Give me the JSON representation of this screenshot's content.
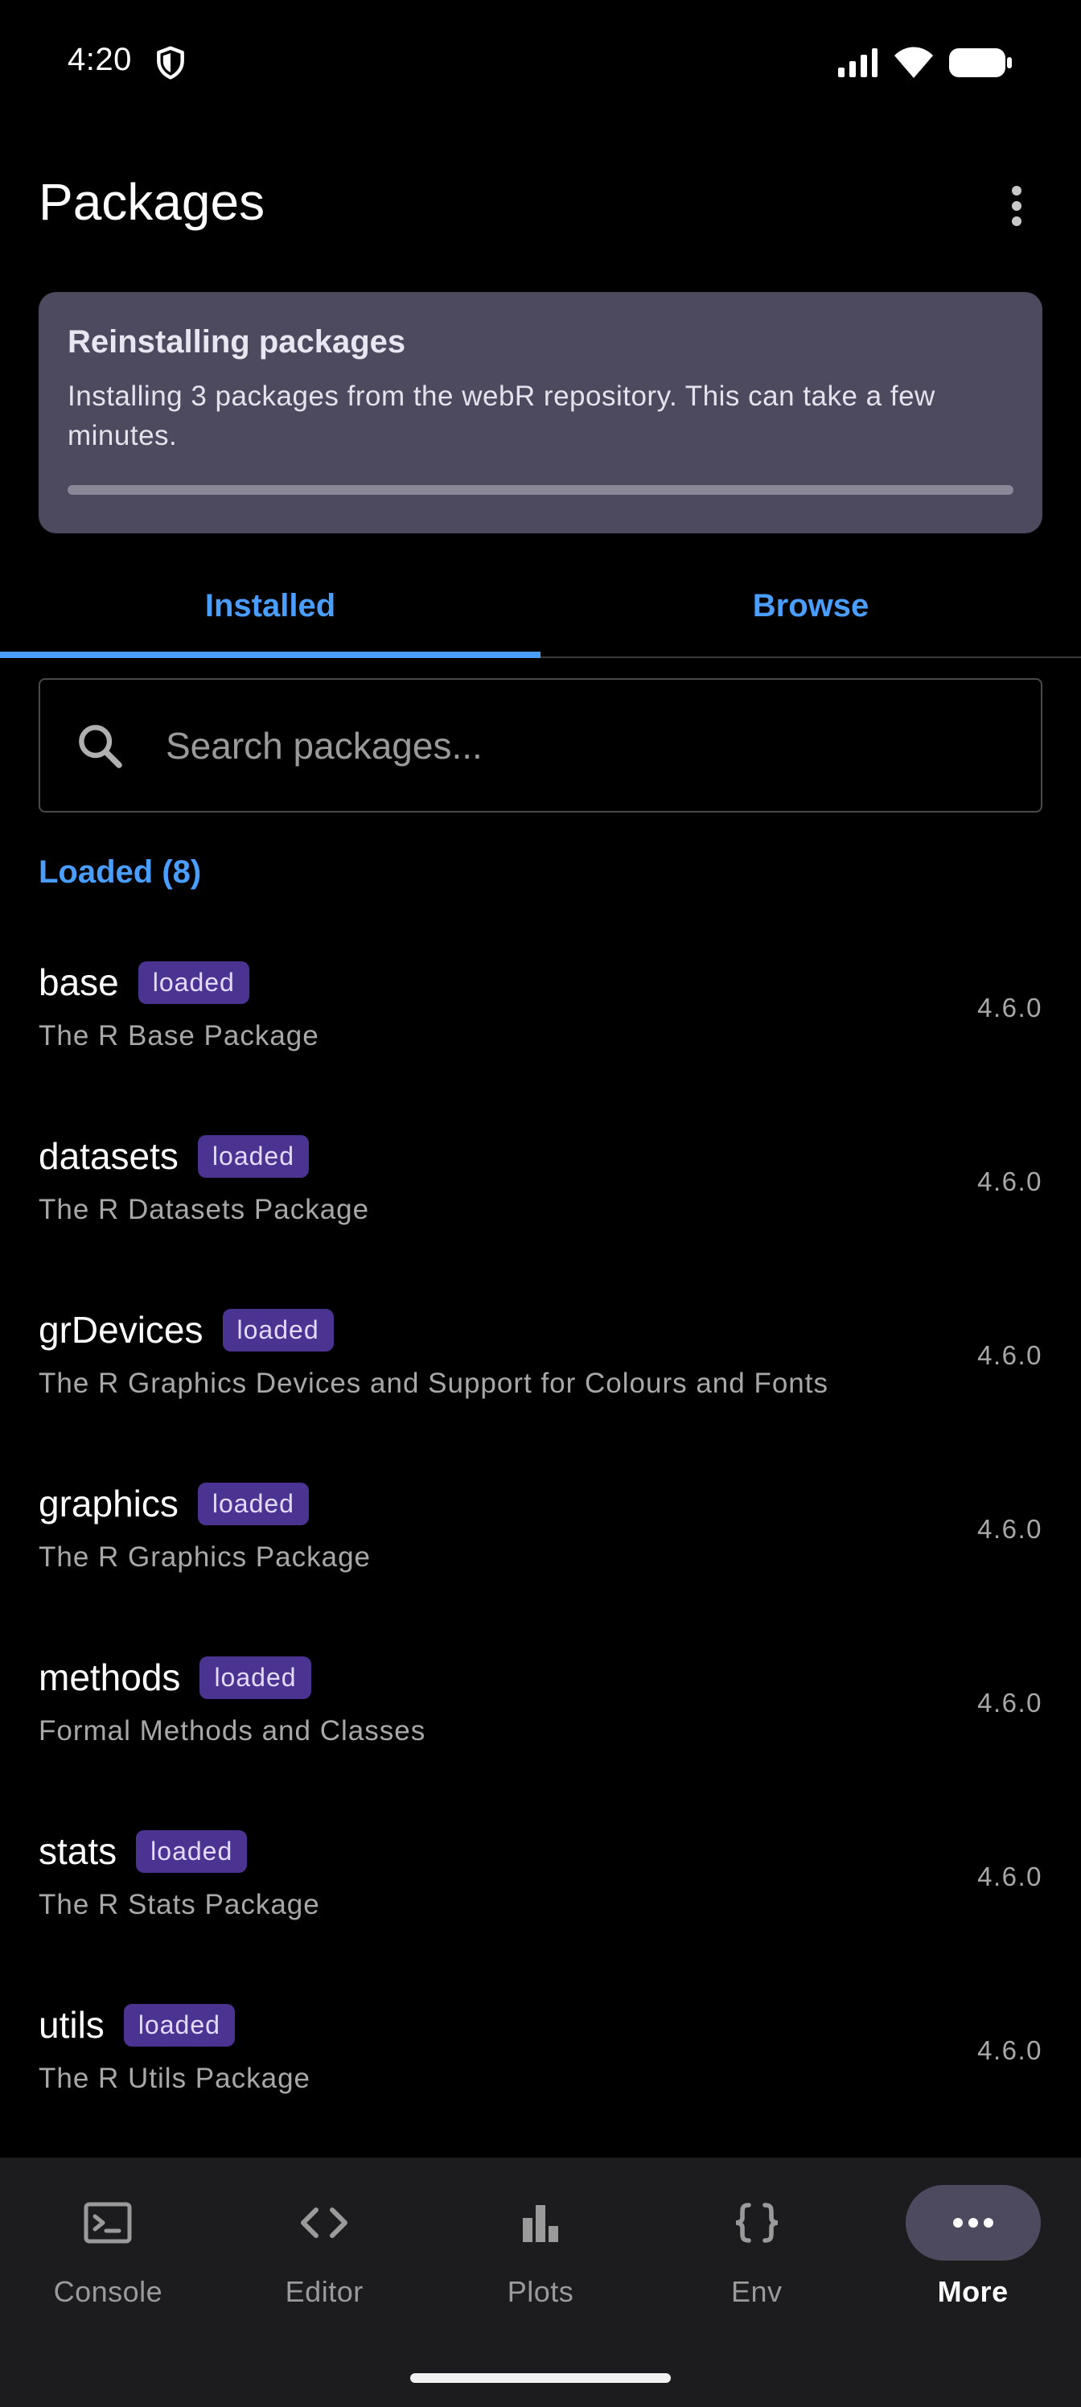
{
  "status_bar": {
    "time": "4:20"
  },
  "app_bar": {
    "title": "Packages"
  },
  "reinstall_card": {
    "title": "Reinstalling packages",
    "body": "Installing 3 packages from the webR repository. This can take a few minutes.",
    "progress_fraction": 1.0
  },
  "tabs": [
    {
      "label": "Installed",
      "active": true
    },
    {
      "label": "Browse",
      "active": false
    }
  ],
  "search": {
    "placeholder": "Search packages...",
    "value": ""
  },
  "section": {
    "header": "Loaded (8)"
  },
  "packages": [
    {
      "name": "base",
      "badge": "loaded",
      "description": "The R Base Package",
      "version": "4.6.0"
    },
    {
      "name": "datasets",
      "badge": "loaded",
      "description": "The R Datasets Package",
      "version": "4.6.0"
    },
    {
      "name": "grDevices",
      "badge": "loaded",
      "description": "The R Graphics Devices and Support for Colours and Fonts",
      "version": "4.6.0"
    },
    {
      "name": "graphics",
      "badge": "loaded",
      "description": "The R Graphics Package",
      "version": "4.6.0"
    },
    {
      "name": "methods",
      "badge": "loaded",
      "description": "Formal Methods and Classes",
      "version": "4.6.0"
    },
    {
      "name": "stats",
      "badge": "loaded",
      "description": "The R Stats Package",
      "version": "4.6.0"
    },
    {
      "name": "utils",
      "badge": "loaded",
      "description": "The R Utils Package",
      "version": "4.6.0"
    }
  ],
  "bottom_nav": [
    {
      "label": "Console",
      "icon": "console-icon",
      "active": false
    },
    {
      "label": "Editor",
      "icon": "code-icon",
      "active": false
    },
    {
      "label": "Plots",
      "icon": "bar-chart-icon",
      "active": false
    },
    {
      "label": "Env",
      "icon": "braces-icon",
      "active": false
    },
    {
      "label": "More",
      "icon": "more-horizontal-icon",
      "active": true
    }
  ],
  "colors": {
    "accent": "#4a9eff",
    "card_bg": "#4d4a5f",
    "badge_bg": "#4b3391",
    "nav_bg": "#1c1c1e"
  }
}
